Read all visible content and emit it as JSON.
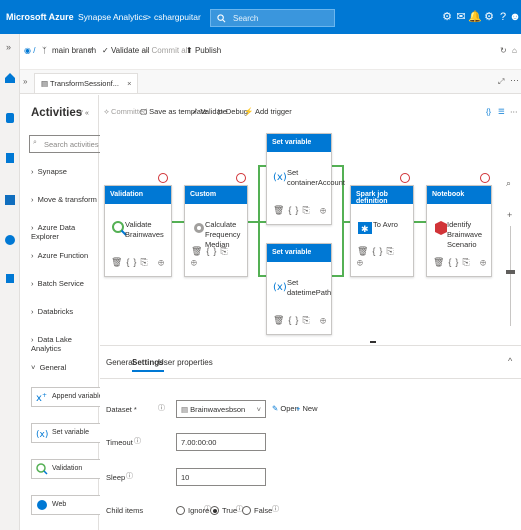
{
  "topbar": {
    "brand": "Microsoft Azure",
    "crumb1": "Synapse Analytics",
    "sep": ">",
    "crumb2": "cshargpuitar",
    "search_placeholder": "Search"
  },
  "row2": {
    "branch": "main branch",
    "validate_all": "Validate all",
    "commit_all": "Commit all",
    "publish": "Publish"
  },
  "tab": {
    "label": "TransformSessionf...",
    "close": "×"
  },
  "activities": {
    "title": "Activities",
    "collapse": "˅ «",
    "search_placeholder": "Search activities",
    "categories": [
      "Synapse",
      "Move & transform",
      "Azure Data Explorer",
      "Azure Function",
      "Batch Service",
      "Databricks",
      "Data Lake Analytics"
    ],
    "general": "General",
    "general_items": [
      "Append variable",
      "Set variable",
      "Validation",
      "Web"
    ]
  },
  "canvas_toolbar": {
    "committed": "Committed",
    "save_template": "Save as template",
    "validate": "Validate",
    "debug": "Debug",
    "add_trigger": "Add trigger"
  },
  "nodes": [
    {
      "header": "Validation",
      "name": "Validate Brainwaves"
    },
    {
      "header": "Custom",
      "name": "Calculate Frequency Median"
    },
    {
      "header": "Set variable",
      "name": "Set containerAccount"
    },
    {
      "header": "Set variable",
      "name": "Set datetimePath"
    },
    {
      "header": "Spark job definition",
      "name": "To Avro"
    },
    {
      "header": "Notebook",
      "name": "Identify Brainwave Scenario"
    }
  ],
  "props": {
    "tabs": [
      "General",
      "Settings",
      "User properties"
    ],
    "dataset_label": "Dataset *",
    "dataset_value": "Brainwavesbson",
    "open": "Open",
    "new": "New",
    "timeout_label": "Timeout",
    "timeout_value": "7.00:00:00",
    "sleep_label": "Sleep",
    "sleep_value": "10",
    "child_label": "Child items",
    "child_options": [
      "Ignore",
      "True",
      "False"
    ],
    "child_selected": "True"
  },
  "colors": {
    "azure_blue": "#0078d4",
    "success_green": "#54b054",
    "error_red": "#d13438"
  }
}
